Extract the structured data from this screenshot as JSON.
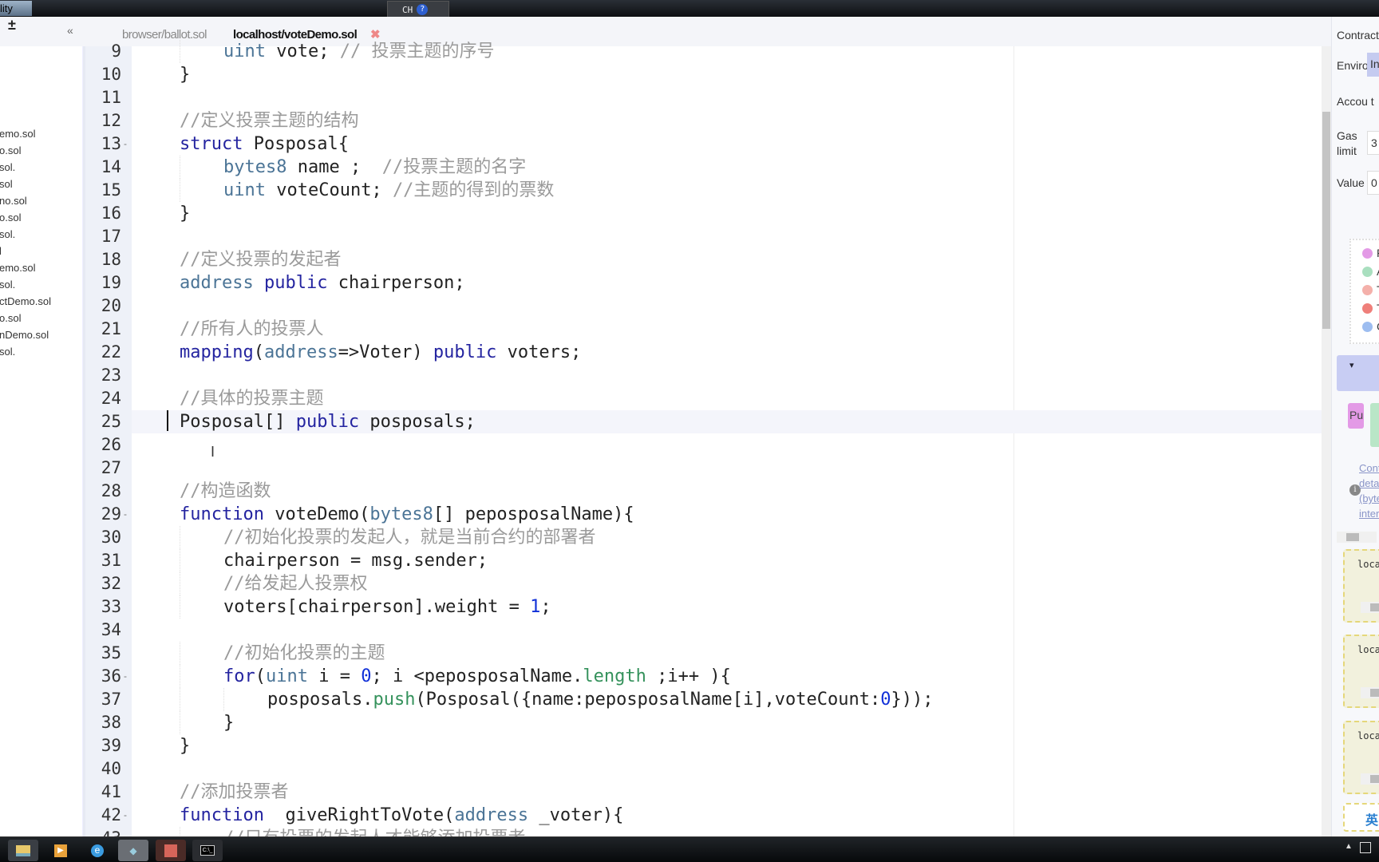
{
  "window": {
    "title": "lity IDE",
    "ime": {
      "label": "CH",
      "help": "?"
    }
  },
  "toolbar": {
    "add_remove": "±",
    "collapse": "«"
  },
  "tabs": [
    {
      "label": "browser/ballot.sol",
      "active": false
    },
    {
      "label": "localhost/voteDemo.sol",
      "active": true,
      "close": "✖"
    }
  ],
  "files": [
    "emo.sol",
    "o.sol",
    ".sol",
    "sol",
    "no.sol",
    "o.sol",
    ".sol",
    "l",
    "emo.sol",
    ".sol",
    "ctDemo.sol",
    "o.sol",
    "nDemo.sol",
    ".sol"
  ],
  "editor": {
    "active_line": 25,
    "lines": [
      {
        "n": 9,
        "indent": 2,
        "tokens": [
          [
            "uint",
            "type"
          ],
          [
            " vote; ",
            ""
          ],
          [
            "// 投票主题的序号",
            "cm"
          ]
        ]
      },
      {
        "n": 10,
        "indent": 1,
        "tokens": [
          [
            "}",
            ""
          ]
        ]
      },
      {
        "n": 11,
        "indent": 0,
        "tokens": []
      },
      {
        "n": 12,
        "indent": 1,
        "tokens": [
          [
            "//定义投票主题的结构",
            "cm"
          ]
        ]
      },
      {
        "n": 13,
        "indent": 1,
        "fold": true,
        "tokens": [
          [
            "struct",
            "kw"
          ],
          [
            " Posposal{",
            ""
          ]
        ]
      },
      {
        "n": 14,
        "indent": 2,
        "tokens": [
          [
            "bytes8",
            "type"
          ],
          [
            " name ;  ",
            ""
          ],
          [
            "//投票主题的名字",
            "cm"
          ]
        ]
      },
      {
        "n": 15,
        "indent": 2,
        "tokens": [
          [
            "uint",
            "type"
          ],
          [
            " voteCount; ",
            ""
          ],
          [
            "//主题的得到的票数",
            "cm"
          ]
        ]
      },
      {
        "n": 16,
        "indent": 1,
        "tokens": [
          [
            "}",
            ""
          ]
        ]
      },
      {
        "n": 17,
        "indent": 0,
        "tokens": []
      },
      {
        "n": 18,
        "indent": 1,
        "tokens": [
          [
            "//定义投票的发起者",
            "cm"
          ]
        ]
      },
      {
        "n": 19,
        "indent": 1,
        "tokens": [
          [
            "address",
            "type"
          ],
          [
            " ",
            ""
          ],
          [
            "public",
            "kw"
          ],
          [
            " chairperson;",
            ""
          ]
        ]
      },
      {
        "n": 20,
        "indent": 0,
        "tokens": []
      },
      {
        "n": 21,
        "indent": 1,
        "tokens": [
          [
            "//所有人的投票人",
            "cm"
          ]
        ]
      },
      {
        "n": 22,
        "indent": 1,
        "tokens": [
          [
            "mapping",
            "kw"
          ],
          [
            "(",
            ""
          ],
          [
            "address",
            "type"
          ],
          [
            "=>Voter) ",
            ""
          ],
          [
            "public",
            "kw"
          ],
          [
            " voters;",
            ""
          ]
        ]
      },
      {
        "n": 23,
        "indent": 0,
        "tokens": []
      },
      {
        "n": 24,
        "indent": 1,
        "tokens": [
          [
            "//具体的投票主题",
            "cm"
          ]
        ]
      },
      {
        "n": 25,
        "indent": 1,
        "tokens": [
          [
            "Posposal[] ",
            ""
          ],
          [
            "public",
            "kw"
          ],
          [
            " posposals;",
            ""
          ]
        ]
      },
      {
        "n": 26,
        "indent": 0,
        "tokens": []
      },
      {
        "n": 27,
        "indent": 0,
        "tokens": []
      },
      {
        "n": 28,
        "indent": 1,
        "tokens": [
          [
            "//构造函数",
            "cm"
          ]
        ]
      },
      {
        "n": 29,
        "indent": 1,
        "fold": true,
        "tokens": [
          [
            "function",
            "kw"
          ],
          [
            " voteDemo(",
            ""
          ],
          [
            "bytes8",
            "type"
          ],
          [
            "[] peposposalName){",
            ""
          ]
        ]
      },
      {
        "n": 30,
        "indent": 2,
        "tokens": [
          [
            "//初始化投票的发起人，就是当前合约的部署者",
            "cm"
          ]
        ]
      },
      {
        "n": 31,
        "indent": 2,
        "tokens": [
          [
            "chairperson = msg.sender;",
            ""
          ]
        ]
      },
      {
        "n": 32,
        "indent": 2,
        "tokens": [
          [
            "//给发起人投票权",
            "cm"
          ]
        ]
      },
      {
        "n": 33,
        "indent": 2,
        "tokens": [
          [
            "voters[chairperson].weight = ",
            ""
          ],
          [
            "1",
            "num"
          ],
          [
            ";",
            ""
          ]
        ]
      },
      {
        "n": 34,
        "indent": 0,
        "tokens": []
      },
      {
        "n": 35,
        "indent": 2,
        "tokens": [
          [
            "//初始化投票的主题",
            "cm"
          ]
        ]
      },
      {
        "n": 36,
        "indent": 2,
        "fold": true,
        "tokens": [
          [
            "for",
            "kw"
          ],
          [
            "(",
            ""
          ],
          [
            "uint",
            "type"
          ],
          [
            " i = ",
            ""
          ],
          [
            "0",
            "num"
          ],
          [
            "; i <peposposalName.",
            ""
          ],
          [
            "length",
            "fn"
          ],
          [
            " ;i++ ){",
            ""
          ]
        ]
      },
      {
        "n": 37,
        "indent": 3,
        "tokens": [
          [
            "posposals.",
            ""
          ],
          [
            "push",
            "fn"
          ],
          [
            "(Posposal({name:peposposalName[i],voteCount:",
            ""
          ],
          [
            "0",
            "num"
          ],
          [
            "}));",
            ""
          ]
        ]
      },
      {
        "n": 38,
        "indent": 2,
        "tokens": [
          [
            "}",
            ""
          ]
        ]
      },
      {
        "n": 39,
        "indent": 1,
        "tokens": [
          [
            "}",
            ""
          ]
        ]
      },
      {
        "n": 40,
        "indent": 0,
        "tokens": []
      },
      {
        "n": 41,
        "indent": 1,
        "tokens": [
          [
            "//添加投票者",
            "cm"
          ]
        ]
      },
      {
        "n": 42,
        "indent": 1,
        "fold": true,
        "tokens": [
          [
            "function",
            "kw"
          ],
          [
            "  giveRightToVote(",
            ""
          ],
          [
            "address",
            "type"
          ],
          [
            " _voter){",
            ""
          ]
        ]
      },
      {
        "n": 43,
        "indent": 2,
        "tokens": [
          [
            "//只有投票的发起人才能够添加投票者",
            "cm"
          ]
        ]
      }
    ]
  },
  "right_panel": {
    "contract_label": "Contract",
    "environment_label": "Enviroı",
    "environment_value": "Inj",
    "account_label": "Accou t",
    "gas_label": "Gas limit",
    "gas_value": "3",
    "value_label": "Value",
    "value_value": "0",
    "legend": [
      {
        "label": "Pu",
        "color": "#e39ae6"
      },
      {
        "label": "At",
        "color": "#a9dfbf"
      },
      {
        "label": "Tr",
        "color": "#f4b0aa"
      },
      {
        "label": "Tr",
        "color": "#ef7f7a"
      },
      {
        "label": "Ca",
        "color": "#9dbdf0"
      }
    ],
    "dropdown_arrow": "▾",
    "buttons": [
      {
        "label": "Pu",
        "color": "#e39ae6"
      },
      {
        "label": "",
        "color": "#b9e6c7"
      }
    ],
    "info_link": [
      "Cont",
      "deta",
      "(byte",
      "inter"
    ],
    "instances": [
      "localh",
      "localh",
      "localh"
    ],
    "ime_widget": "英"
  },
  "taskbar": {
    "apps": [
      "file-explorer",
      "media-player",
      "internet-explorer",
      "remix-app",
      "office-app",
      "command-prompt"
    ]
  }
}
